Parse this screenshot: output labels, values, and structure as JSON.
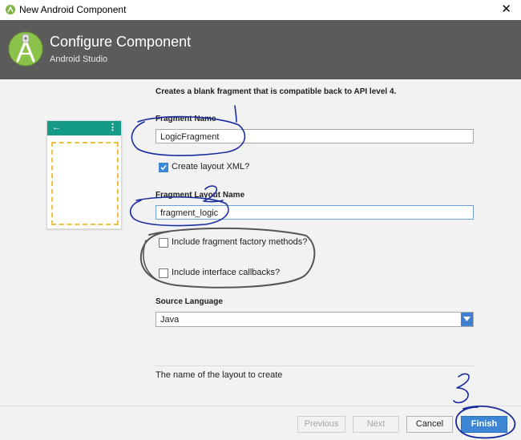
{
  "window": {
    "title": "New Android Component",
    "close_glyph": "✕"
  },
  "header": {
    "title": "Configure Component",
    "subtitle": "Android Studio",
    "logo_icon": "android-studio-logo-icon"
  },
  "description": "Creates a blank fragment that is compatible back to API level 4.",
  "preview": {
    "back_glyph": "←",
    "menu_glyph": "⋮"
  },
  "form": {
    "fragment_name": {
      "label": "Fragment Name",
      "value": "LogicFragment"
    },
    "create_layout_xml": {
      "label": "Create layout XML?",
      "checked": true
    },
    "fragment_layout_name": {
      "label": "Fragment Layout Name",
      "value": "fragment_logic"
    },
    "include_factory_methods": {
      "label": "Include fragment factory methods?",
      "checked": false
    },
    "include_interface_callbacks": {
      "label": "Include interface callbacks?",
      "checked": false
    },
    "source_language": {
      "label": "Source Language",
      "value": "Java"
    }
  },
  "hint": "The name of the layout to create",
  "buttons": {
    "previous": "Previous",
    "next": "Next",
    "cancel": "Cancel",
    "finish": "Finish"
  },
  "colors": {
    "header_bg": "#5b5b5b",
    "accent": "#3d86d6",
    "preview_bar": "#159a88",
    "annotation_ink": "#1a2d9c"
  }
}
